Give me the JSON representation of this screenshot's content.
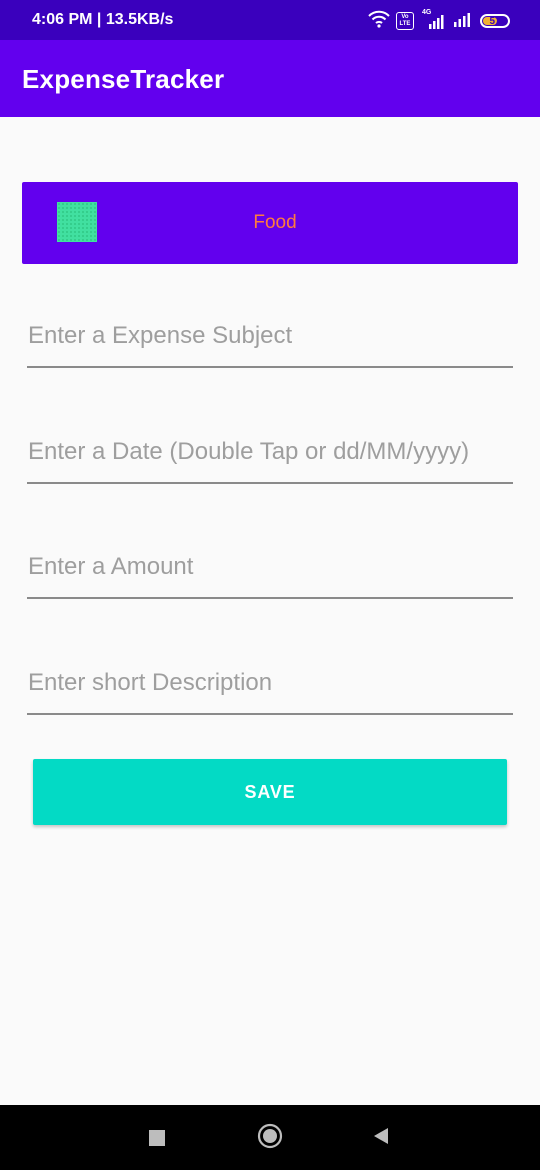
{
  "status_bar": {
    "time_speed": "4:06 PM | 13.5KB/s",
    "network_badge_vo": "Vo",
    "network_badge_lte": "LTE",
    "network_type": "4G",
    "battery_level": "57",
    "background_color": "#3a00bd"
  },
  "app_bar": {
    "title": "ExpenseTracker",
    "background_color": "#6200ee"
  },
  "category": {
    "selected_label": "Food",
    "swatch_color": "#41e0a0",
    "label_color": "#ff7a3d"
  },
  "form": {
    "subject_placeholder": "Enter a Expense Subject",
    "date_placeholder": "Enter a Date (Double Tap or dd/MM/yyyy)",
    "amount_placeholder": "Enter a Amount",
    "description_placeholder": "Enter short Description"
  },
  "save_button": {
    "label": "SAVE",
    "background_color": "#03dac5"
  },
  "nav_bar": {
    "recents_icon": "square-icon",
    "home_icon": "circle-icon",
    "back_icon": "triangle-back-icon"
  }
}
